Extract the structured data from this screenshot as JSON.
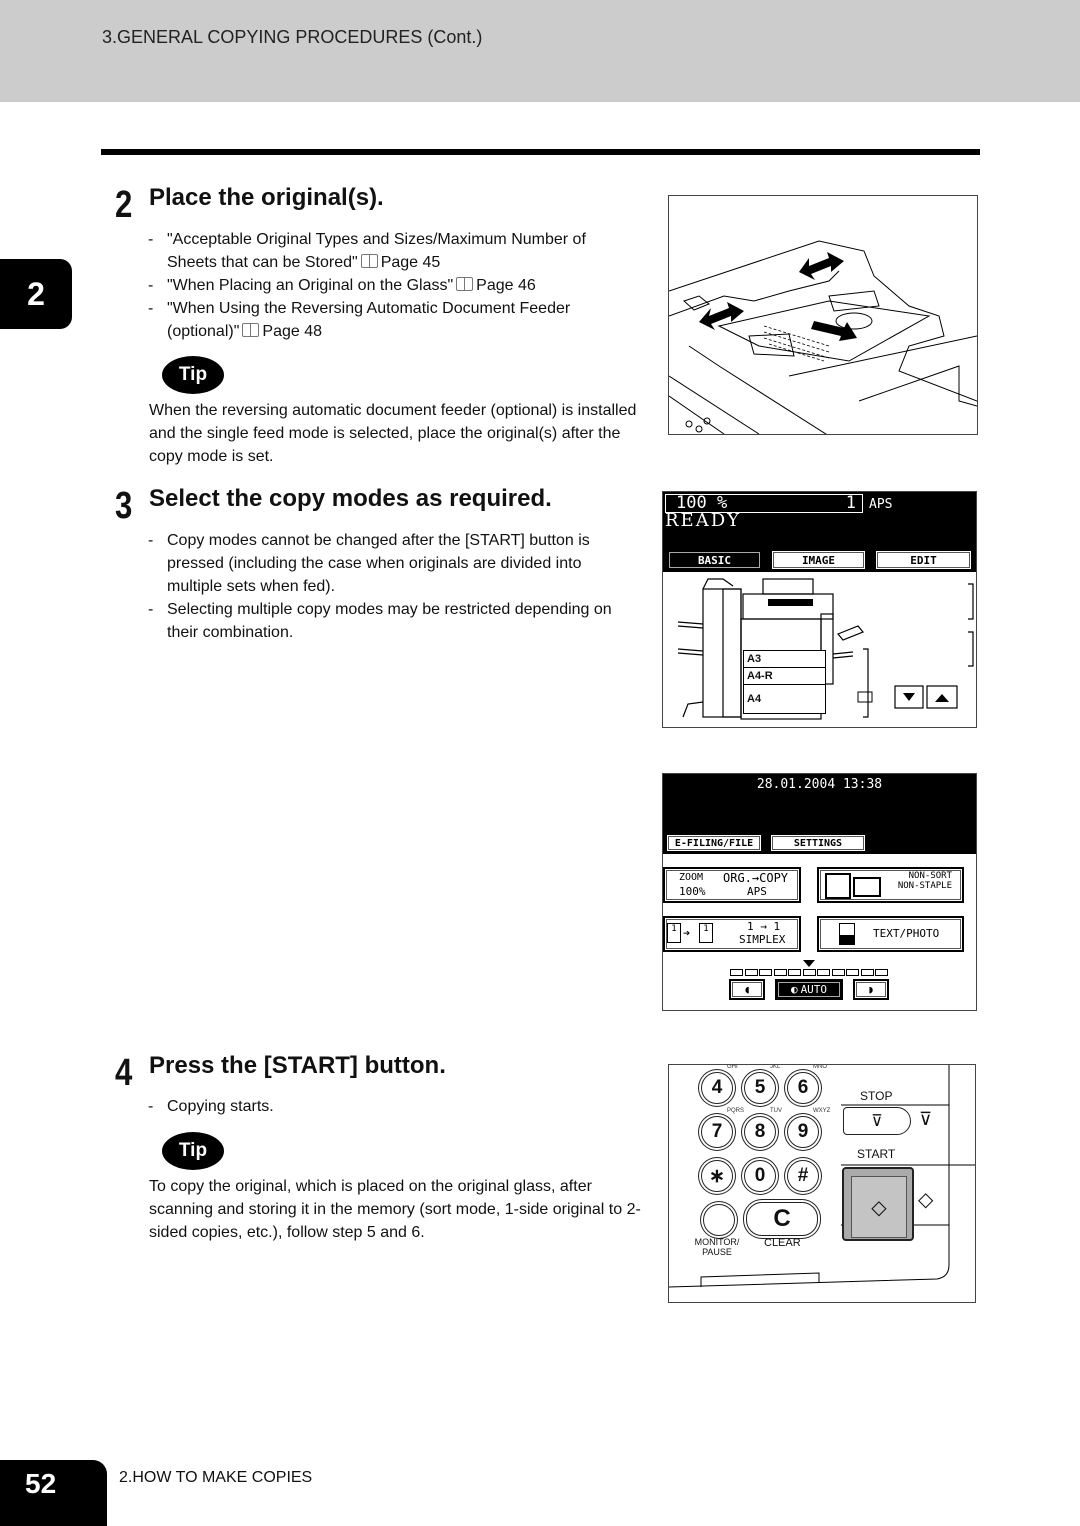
{
  "header": {
    "title": "3.GENERAL COPYING PROCEDURES (Cont.)"
  },
  "chapter_tab": {
    "label": "2"
  },
  "steps": [
    {
      "number": "2",
      "title": "Place the original(s).",
      "bullets": [
        {
          "text": "\"Acceptable Original Types and Sizes/Maximum Number of Sheets that can be Stored\"",
          "ref_icon": "book-icon",
          "ref": "Page 45"
        },
        {
          "text": "\"When Placing an Original on the Glass\"",
          "ref_icon": "book-icon",
          "ref": "Page 46"
        },
        {
          "text": "\"When Using the Reversing Automatic Document Feeder (optional)\"",
          "ref_icon": "book-icon",
          "ref": "Page 48"
        }
      ],
      "tip": {
        "badge": "Tip",
        "text": "When the reversing automatic document feeder (optional) is installed and the single feed mode is selected, place the original(s) after the copy mode is set."
      }
    },
    {
      "number": "3",
      "title": "Select the copy modes as required.",
      "bullets": [
        {
          "text": "Copy modes cannot be changed after the [START] button is pressed (including the case when originals are divided into multiple sets when fed)."
        },
        {
          "text": "Selecting multiple copy modes may be restricted depending on their combination."
        }
      ]
    },
    {
      "number": "4",
      "title": "Press the [START] button.",
      "bullets": [
        {
          "text": "Copying starts."
        }
      ],
      "tip": {
        "badge": "Tip",
        "text": "To copy the original, which is placed on the original glass, after scanning and storing it in the memory (sort mode, 1-side original to 2-sided copies, etc.), follow step 5 and 6."
      }
    }
  ],
  "lcd_basic": {
    "zoom": "100  %",
    "copies": "1",
    "paper_mode": "APS",
    "status": "READY",
    "tabs": [
      "BASIC",
      "IMAGE",
      "EDIT"
    ],
    "active_tab": "BASIC",
    "trays": [
      "A3",
      "A4-R",
      "A4"
    ]
  },
  "lcd_settings": {
    "datetime": "28.01.2004 13:38",
    "tabs": [
      "E-FILING/FILE",
      "SETTINGS"
    ],
    "zoom_button": {
      "label": "ZOOM",
      "value": "100%",
      "org_copy": "ORG.→COPY",
      "paper": "APS"
    },
    "finish_button": {
      "line1": "NON-SORT",
      "line2": "NON-STAPLE"
    },
    "duplex_button": {
      "line1": "1 → 1",
      "line2": "SIMPLEX"
    },
    "image_button": {
      "label": "TEXT/PHOTO"
    },
    "density": {
      "auto_label": "AUTO",
      "level_count": 11,
      "selected_level": 6
    }
  },
  "control_panel": {
    "keys": [
      {
        "label": "4",
        "sub": "GHI"
      },
      {
        "label": "5",
        "sub": "JKL"
      },
      {
        "label": "6",
        "sub": "MNO"
      },
      {
        "label": "7",
        "sub": "PQRS"
      },
      {
        "label": "8",
        "sub": "TUV"
      },
      {
        "label": "9",
        "sub": "WXYZ"
      },
      {
        "label": "∗",
        "sub": ""
      },
      {
        "label": "0",
        "sub": ""
      },
      {
        "label": "#",
        "sub": ""
      }
    ],
    "clear_key": "C",
    "clear_label": "CLEAR",
    "monitor_label_1": "MONITOR/",
    "monitor_label_2": "PAUSE",
    "stop_label": "STOP",
    "start_label": "START"
  },
  "footer": {
    "page_number": "52",
    "section": "2.HOW TO MAKE COPIES"
  }
}
